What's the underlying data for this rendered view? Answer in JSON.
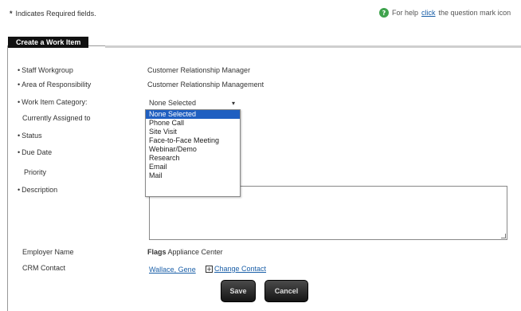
{
  "header": {
    "required_star": "*",
    "required_note": "Indicates Required fields.",
    "help_icon": "question-mark-icon",
    "help_prefix": "For help",
    "help_link": "click",
    "help_suffix": "the question mark icon"
  },
  "panel": {
    "title": "Create a Work Item"
  },
  "fields": {
    "staff_workgroup_label": "Staff Workgroup",
    "staff_workgroup_value": "Customer Relationship Manager",
    "area_label": "Area of Responsibility",
    "area_value": "Customer Relationship Management",
    "category_label": "Work Item Category:",
    "category_selected": "None Selected",
    "assigned_label": "Currently Assigned to",
    "status_label": "Status",
    "due_date_label": "Due Date",
    "priority_label": "Priority",
    "description_label": "Description",
    "employer_label": "Employer Name",
    "employer_bold": "Flags",
    "employer_rest": "Appliance Center",
    "crm_contact_label": "CRM Contact",
    "crm_contact_value": "Wallace, Gene",
    "change_contact": "Change Contact"
  },
  "dropdown": {
    "options": [
      "None Selected",
      "Phone Call",
      "Site Visit",
      "Face-to-Face Meeting",
      "Webinar/Demo",
      "Research",
      "Email",
      "Mail"
    ],
    "highlighted": "None Selected"
  },
  "buttons": {
    "save": "Save",
    "cancel": "Cancel"
  },
  "colors": {
    "highlight": "#1f5fc1",
    "link": "#1a5fa8",
    "help": "#3fa34d"
  }
}
